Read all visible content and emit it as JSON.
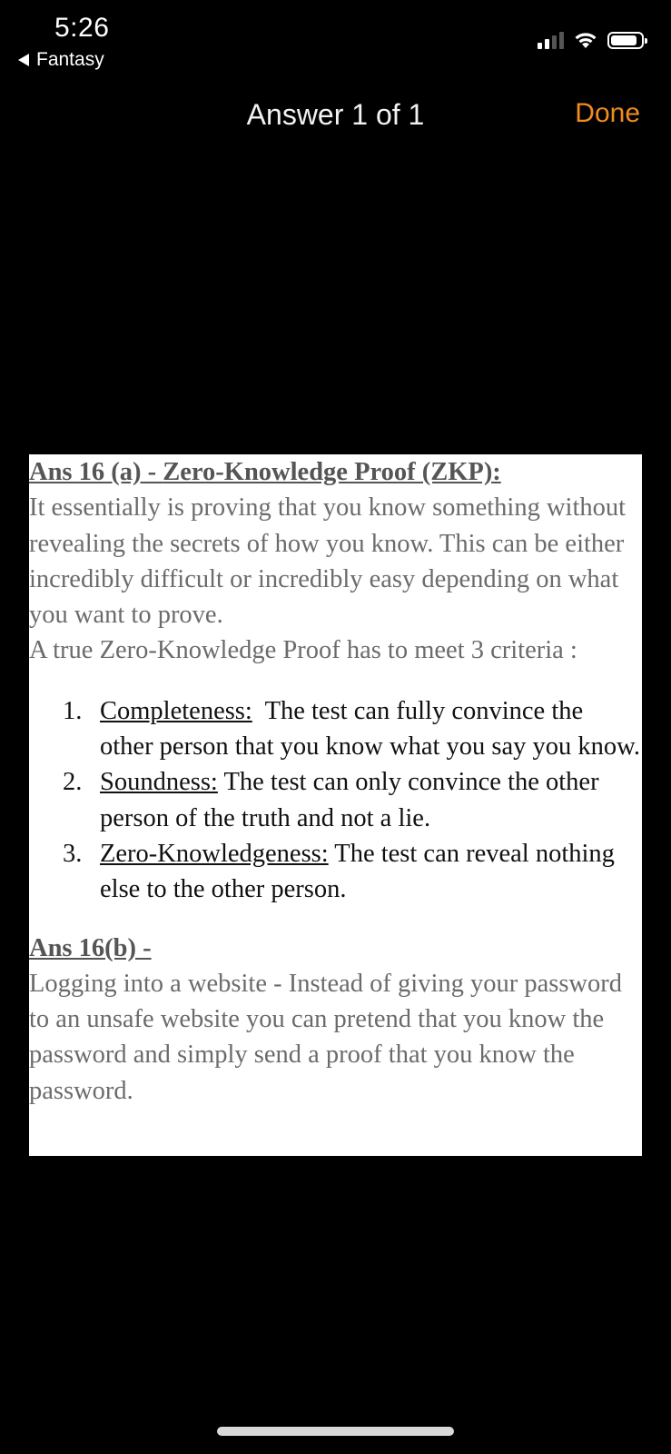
{
  "status_bar": {
    "time": "5:26",
    "back_label": "Fantasy"
  },
  "nav": {
    "title": "Answer 1 of 1",
    "done_label": "Done",
    "accent_color": "#f28b1e"
  },
  "document": {
    "heading_a_prefix": "Ans 16 (a) - ",
    "heading_a_title": "Zero-Knowledge Proof  (ZKP):",
    "paragraph_a": "It essentially is proving that you know something without revealing the secrets of how you know. This can be either incredibly difficult or incredibly easy depending on what you want to prove.",
    "criteria_intro": "A true Zero-Knowledge Proof has to meet 3 criteria :",
    "criteria": [
      {
        "number": "1.",
        "term": "Completeness:",
        "text": "  The test can fully convince the other person that you know what you say you know."
      },
      {
        "number": "2.",
        "term": "Soundness:",
        "text": " The test can only convince the other person of the truth and not a lie."
      },
      {
        "number": "3.",
        "term": "Zero-Knowledgeness:",
        "text": " The test can reveal nothing else to the other person."
      }
    ],
    "heading_b": "Ans 16(b) -",
    "paragraph_b": "Logging into a website - Instead of giving your password to an unsafe website you can pretend that you know the password and simply send a proof that you know the password."
  }
}
